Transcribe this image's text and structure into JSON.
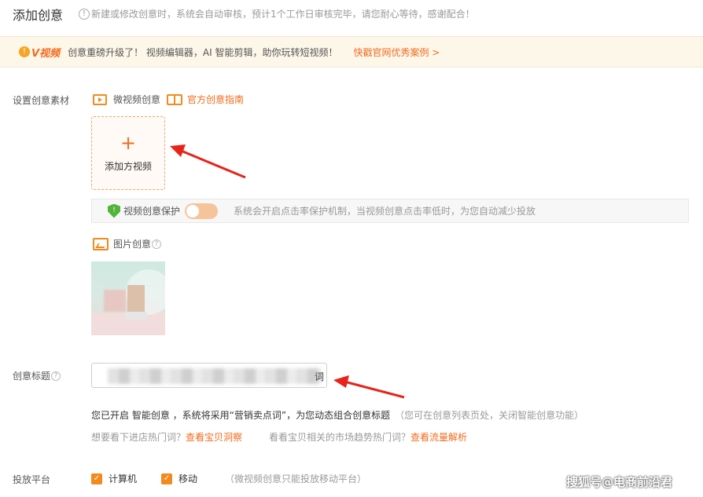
{
  "header": {
    "title": "添加创意",
    "notice_icon": "!",
    "notice": "新建或修改创意时，系统会自动审核，预计1个工作日审核完毕，请您耐心等待，感谢配合！"
  },
  "banner": {
    "icon": "!",
    "logo": "V视频",
    "text": "创意重磅升级了！ 视频编辑器，AI 智能剪辑，助你玩转短视频！",
    "link": "快戳官网优秀案例 >"
  },
  "material": {
    "label": "设置创意素材",
    "video_head": "微视频创意",
    "guide_link": "官方创意指南",
    "add_icon": "+",
    "add_label": "添加方视频",
    "protect": {
      "icon": "!",
      "label": "视频创意保护",
      "desc": "系统会开启点击率保护机制，当视频创意点击率低时，为您自动减少投放"
    },
    "pic_head": "图片创意",
    "help_icon": "?"
  },
  "title_field": {
    "label": "创意标题",
    "help_icon": "?",
    "value_tail": "词"
  },
  "smart": {
    "text": "您已开启 智能创意 ，系统将采用“营销卖点词”，为您动态组合创意标题",
    "muted": "（您可在创意列表页处，关闭智能创意功能）",
    "hint1_text": "想要看下进店热门词？",
    "hint1_link": "查看宝贝洞察",
    "hint2_text": "看看宝贝相关的市场趋势热门词？",
    "hint2_link": "查看流量解析"
  },
  "platform": {
    "label": "投放平台",
    "check_mark": "✓",
    "opt1": "计算机",
    "opt2": "移动",
    "note": "（微视频创意只能投放移动平台）"
  },
  "watermark": "搜狐号@电商前沿君",
  "colors": {
    "accent": "#f26b1d",
    "banner_bg": "#fdf7ea",
    "arrow": "#e8231a"
  }
}
